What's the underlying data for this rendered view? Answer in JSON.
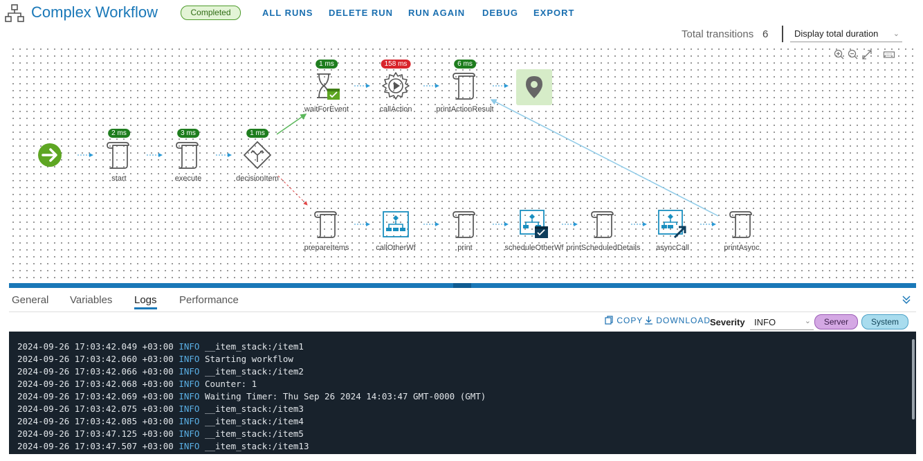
{
  "header": {
    "title": "Complex Workflow",
    "status": "Completed",
    "actions": [
      "ALL RUNS",
      "DELETE RUN",
      "RUN AGAIN",
      "DEBUG",
      "EXPORT"
    ],
    "total_transitions_label": "Total transitions",
    "total_transitions_value": "6",
    "duration_select": "Display total duration"
  },
  "colors": {
    "accent": "#1a78b8",
    "success": "#1e7d1e",
    "error": "#d8232a",
    "log_bg": "#18222c"
  },
  "diagram": {
    "nodes": [
      {
        "id": "start-event",
        "name": "",
        "icon": "arrow-right-icon"
      },
      {
        "id": "start",
        "name": "start",
        "icon": "scroll-icon",
        "duration": "2 ms"
      },
      {
        "id": "execute",
        "name": "execute",
        "icon": "scroll-icon",
        "duration": "3 ms"
      },
      {
        "id": "decisionItem",
        "name": "decisionItem",
        "icon": "decision-icon",
        "duration": "1 ms"
      },
      {
        "id": "waitForEvent",
        "name": "waitForEvent",
        "icon": "hourglass-calendar-icon",
        "duration": "1 ms"
      },
      {
        "id": "callAction",
        "name": "callAction",
        "icon": "gear-play-icon",
        "duration": "158 ms",
        "duration_status": "error"
      },
      {
        "id": "printActionResult",
        "name": "printActionResult",
        "icon": "scroll-icon",
        "duration": "6 ms"
      },
      {
        "id": "end",
        "name": "",
        "icon": "map-pin-icon"
      },
      {
        "id": "prepareItems",
        "name": "prepareItems",
        "icon": "scroll-icon"
      },
      {
        "id": "callOtherWf",
        "name": "callOtherWf",
        "icon": "workflow-icon"
      },
      {
        "id": "print",
        "name": "print",
        "icon": "scroll-icon"
      },
      {
        "id": "scheduleOtherWf",
        "name": "scheduleOtherWf",
        "icon": "workflow-calendar-icon"
      },
      {
        "id": "printScheduledDetails",
        "name": "printScheduledDetails",
        "icon": "scroll-icon"
      },
      {
        "id": "asyncCall",
        "name": "asyncCall",
        "icon": "workflow-async-icon"
      },
      {
        "id": "printAsync",
        "name": "printAsync",
        "icon": "scroll-icon"
      }
    ],
    "toolbar_icons": [
      "zoom-in-icon",
      "zoom-out-icon",
      "fit-screen-icon",
      "keyboard-icon"
    ]
  },
  "tabs": [
    "General",
    "Variables",
    "Logs",
    "Performance"
  ],
  "active_tab": "Logs",
  "logs_toolbar": {
    "copy": "COPY",
    "download": "DOWNLOAD",
    "severity_label": "Severity",
    "severity_value": "INFO",
    "filters": [
      "Server",
      "System"
    ]
  },
  "logs": [
    {
      "ts": "2024-09-26 17:03:42.049 +03:00",
      "level": "INFO",
      "msg": "__item_stack:/item1"
    },
    {
      "ts": "2024-09-26 17:03:42.060 +03:00",
      "level": "INFO",
      "msg": "Starting workflow"
    },
    {
      "ts": "2024-09-26 17:03:42.066 +03:00",
      "level": "INFO",
      "msg": "__item_stack:/item2"
    },
    {
      "ts": "2024-09-26 17:03:42.068 +03:00",
      "level": "INFO",
      "msg": "Counter: 1"
    },
    {
      "ts": "2024-09-26 17:03:42.069 +03:00",
      "level": "INFO",
      "msg": "Waiting Timer: Thu Sep 26 2024 14:03:47 GMT-0000 (GMT)"
    },
    {
      "ts": "2024-09-26 17:03:42.075 +03:00",
      "level": "INFO",
      "msg": "__item_stack:/item3"
    },
    {
      "ts": "2024-09-26 17:03:42.085 +03:00",
      "level": "INFO",
      "msg": "__item_stack:/item4"
    },
    {
      "ts": "2024-09-26 17:03:47.125 +03:00",
      "level": "INFO",
      "msg": "__item_stack:/item5"
    },
    {
      "ts": "2024-09-26 17:03:47.507 +03:00",
      "level": "INFO",
      "msg": "__item_stack:/item13"
    }
  ]
}
